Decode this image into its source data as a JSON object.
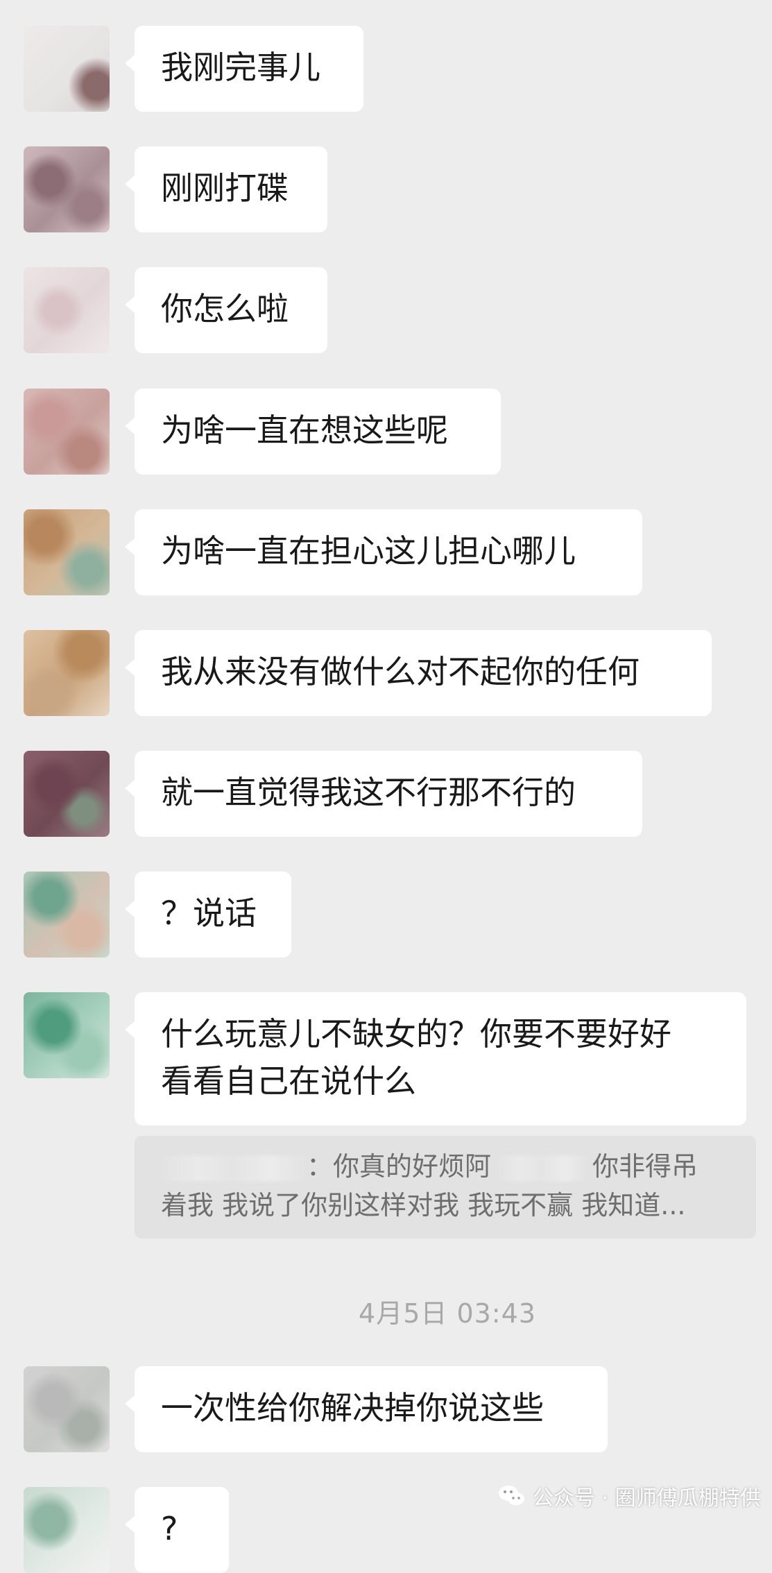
{
  "messages": [
    {
      "text": "我刚完事儿"
    },
    {
      "text": "刚刚打碟"
    },
    {
      "text": "你怎么啦"
    },
    {
      "text": "为啥一直在想这些呢"
    },
    {
      "text": "为啥一直在担心这儿担心哪儿"
    },
    {
      "text": "我从来没有做什么对不起你的任何"
    },
    {
      "text": "就一直觉得我这不行那不行的"
    },
    {
      "text": "？说话"
    },
    {
      "text": "什么玩意儿不缺女的？你要不要好好\n看看自己在说什么"
    },
    {
      "text": "一次性给你解决掉你说这些"
    },
    {
      "text": "?"
    }
  ],
  "quote": {
    "part1": "：你真的好烦阿",
    "part2": "你非得吊",
    "line2": "着我 我说了你别这样对我 我玩不赢 我知道..."
  },
  "timestamp": "4月5日 03:43",
  "watermark": {
    "label": "公众号 · 圈师傅瓜棚特供",
    "icon": "wechat-icon"
  },
  "colors": {
    "background": "#ededed",
    "bubble": "#ffffff",
    "quote_bg": "#e2e2e2",
    "timestamp": "#a8a8a8"
  }
}
